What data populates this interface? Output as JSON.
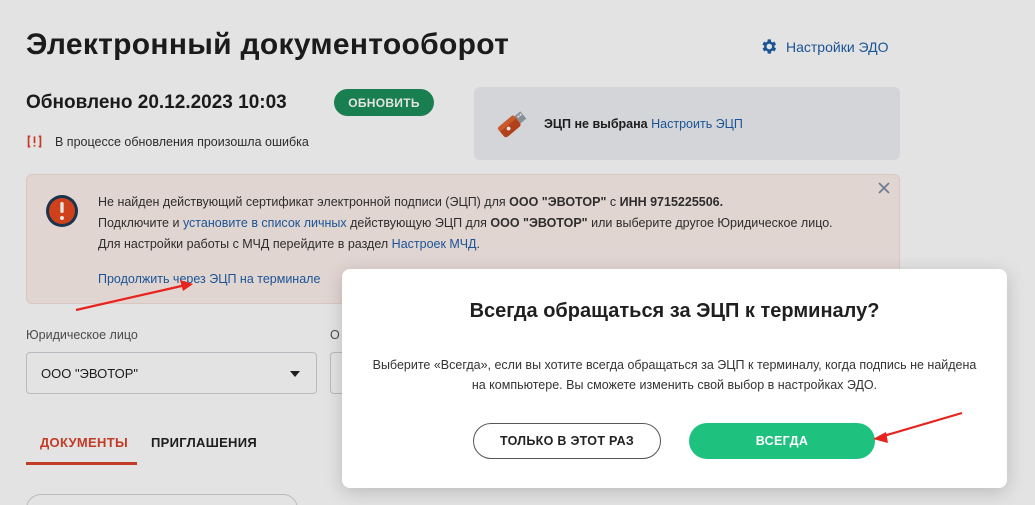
{
  "header": {
    "title": "Электронный документооборот",
    "settings_label": "Настройки ЭДО"
  },
  "status": {
    "updated_text": "Обновлено 20.12.2023 10:03",
    "refresh_label": "ОБНОВИТЬ",
    "error_text": "В процессе обновления произошла ошибка"
  },
  "ecp_card": {
    "status_text": "ЭЦП не выбрана",
    "setup_link": "Настроить ЭЦП"
  },
  "alert": {
    "line1_a": "Не найден действующий сертификат электронной подписи (ЭЦП) для",
    "line1_org": "ООО \"ЭВОТОР\"",
    "line1_c": "с",
    "line1_inn": "ИНН 9715225506.",
    "line2_a": "Подключите и",
    "line2_link": "установите в список личных",
    "line2_b": "действующую ЭЦП для",
    "line2_org": "ООО \"ЭВОТОР\"",
    "line2_c": "или выберите другое Юридическое лицо.",
    "line3_a": "Для настройки работы с МЧД перейдите в раздел",
    "line3_link": "Настроек МЧД",
    "line3_end": ".",
    "continue_link": "Продолжить через ЭЦП на терминале"
  },
  "filters": {
    "legal_label": "Юридическое лицо",
    "legal_value": "ООО \"ЭВОТОР\"",
    "other_label_fragment": "О"
  },
  "tabs": [
    {
      "label": "ДОКУМЕНТЫ",
      "active": true
    },
    {
      "label": "ПРИГЛАШЕНИЯ",
      "active": false
    }
  ],
  "modal": {
    "title": "Всегда обращаться за ЭЦП к терминалу?",
    "body_line1": "Выберите «Всегда», если вы хотите всегда обращаться за ЭЦП к терминалу, когда подпись не найдена",
    "body_line2": "на компьютере. Вы сможете изменить свой выбор в настройках ЭДО.",
    "once_label": "ТОЛЬКО В ЭТОТ РАЗ",
    "always_label": "ВСЕГДА"
  },
  "colors": {
    "accent_green": "#1d8f5a",
    "always_green": "#1fc17f",
    "link_blue": "#1f5fa8",
    "tab_red": "#d9432b",
    "alert_bg": "#fdf0ec",
    "annotation_arrow": "#e8221c"
  },
  "icons": [
    "gear-icon",
    "sync-error-icon",
    "usb-key-icon",
    "warning-icon",
    "close-icon",
    "chevron-down-icon"
  ]
}
